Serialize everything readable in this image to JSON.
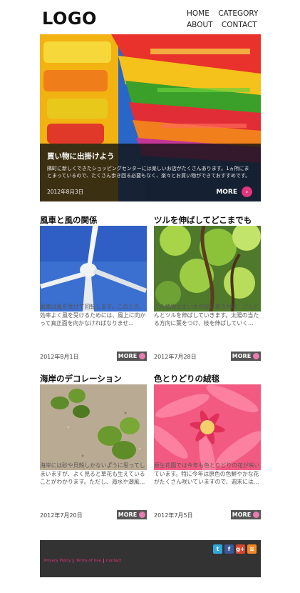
{
  "header": {
    "logo": "LOGO",
    "nav_row1": [
      "HOME",
      "CATEGORY"
    ],
    "nav_row2": [
      "ABOUT",
      "CONTACT"
    ]
  },
  "hero": {
    "title": "買い物に出掛けよう",
    "description": "隣町に新しくできたショッピングセンターには楽しいお店がたくさんあります。1ヵ所にまとまっているので、たくさん歩き回る必要もなく、楽々とお買い物ができておすすめです。",
    "date": "2012年8月3日",
    "more": "MORE"
  },
  "cards": [
    {
      "title": "風車と風の関係",
      "description": "風車は風を受けて回転します。このとき、効率よく風を受けるためには、風上に向かって真正面を向かなければなりませ…",
      "date": "2012年8月1日",
      "more": "MORE"
    },
    {
      "title": "ツルを伸ばしてどこまでも",
      "description": "ツル植物は太い木の幹に巻き付き、どんどんとツルを伸ばしていきます。太陽の当たる方向に葉をつけ、枝を伸ばしていく…",
      "date": "2012年7月28日",
      "more": "MORE"
    },
    {
      "title": "海岸のデコレーション",
      "description": "海岸には砂や貝殻しかないように思ってしまいますが、よく見ると草花も生えていることがわかります。ただし、海水や潮風…",
      "date": "2012年7月20日",
      "more": "MORE"
    },
    {
      "title": "色とりどりの絨毯",
      "description": "原生花園では今年も色とりどりの花が咲いています。特に今年は原色の色鮮やかな花がたくさん咲いていますので、週末には…",
      "date": "2012年7月5日",
      "more": "MORE"
    }
  ],
  "footer": {
    "links": [
      "Privacy Policy",
      "Terms of Use",
      "Contact"
    ],
    "social": [
      {
        "icon": "twitter-icon",
        "glyph": "t",
        "color": "#2fa8e0"
      },
      {
        "icon": "facebook-icon",
        "glyph": "f",
        "color": "#3b5998"
      },
      {
        "icon": "google-plus-icon",
        "glyph": "g+",
        "color": "#d9452f"
      },
      {
        "icon": "rss-icon",
        "glyph": "≋",
        "color": "#f08a24"
      }
    ]
  }
}
